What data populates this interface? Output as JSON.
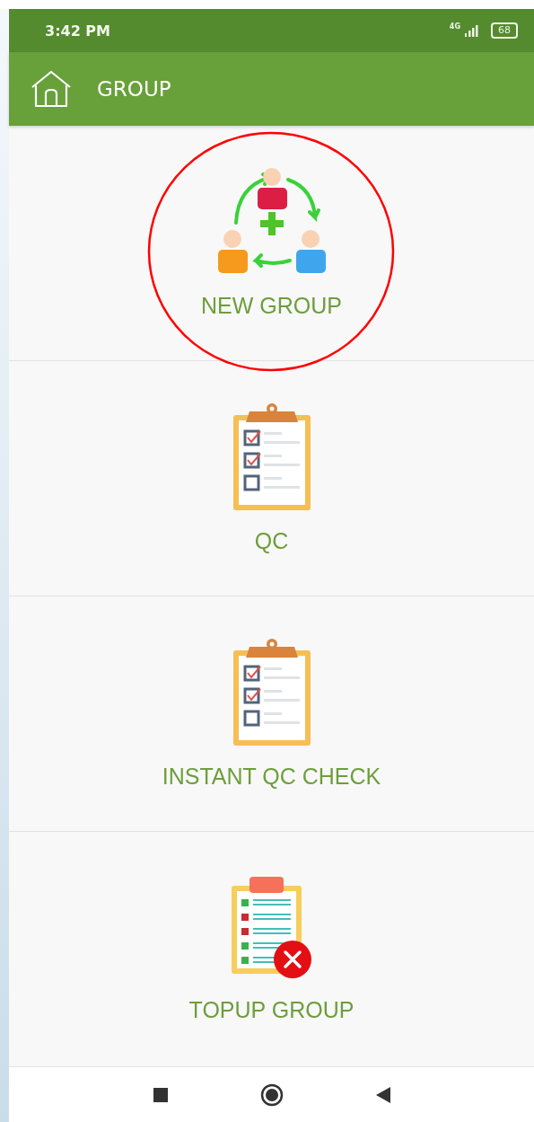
{
  "status_bar": {
    "time": "3:42 PM",
    "network": "4G",
    "battery": "68"
  },
  "app_bar": {
    "title": "GROUP"
  },
  "items": [
    {
      "kind": "group",
      "label": "NEW GROUP",
      "highlighted": true
    },
    {
      "kind": "clipboard",
      "label": "QC",
      "highlighted": false
    },
    {
      "kind": "clipboard",
      "label": "INSTANT QC CHECK",
      "highlighted": false
    },
    {
      "kind": "topup",
      "label": "TOPUP GROUP",
      "highlighted": false
    }
  ]
}
